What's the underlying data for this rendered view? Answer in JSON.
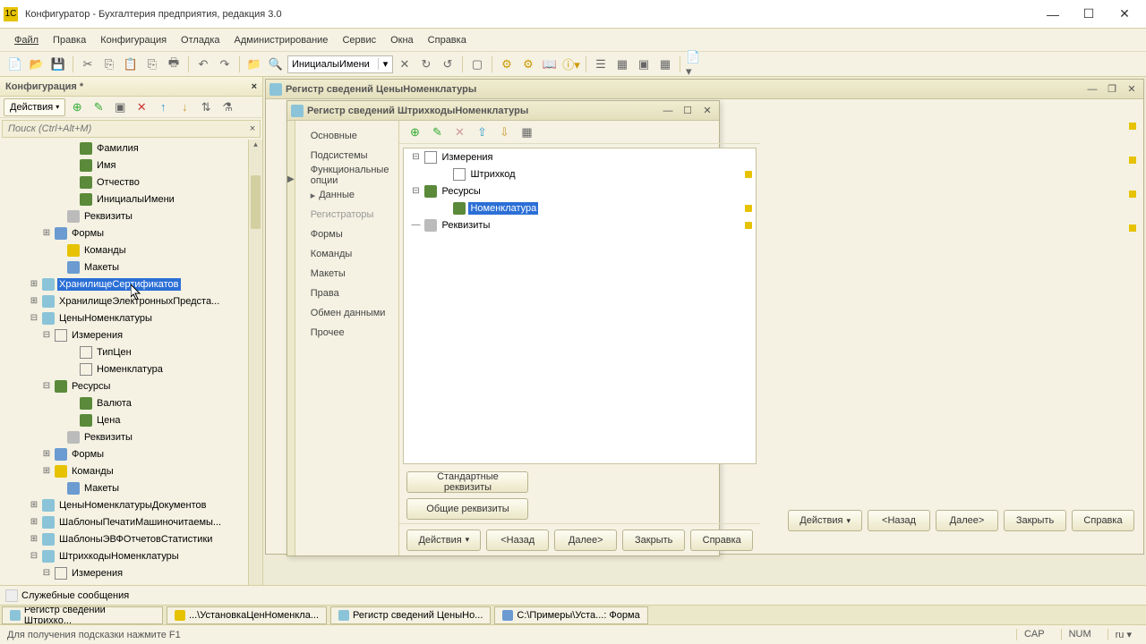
{
  "window": {
    "title": "Конфигуратор - Бухгалтерия предприятия, редакция 3.0",
    "min": "—",
    "max": "☐",
    "close": "✕"
  },
  "menu": {
    "file": "Файл",
    "edit": "Правка",
    "config": "Конфигурация",
    "debug": "Отладка",
    "admin": "Администрирование",
    "service": "Сервис",
    "windows": "Окна",
    "help": "Справка"
  },
  "toolbar": {
    "combo_value": "ИнициалыИмени"
  },
  "config_panel": {
    "title": "Конфигурация *",
    "actions": "Действия",
    "search_placeholder": "Поиск (Ctrl+Alt+M)",
    "tree": [
      {
        "indent": 5,
        "ico": "green",
        "label": "Фамилия",
        "mark": true
      },
      {
        "indent": 5,
        "ico": "green",
        "label": "Имя",
        "mark": true
      },
      {
        "indent": 5,
        "ico": "green",
        "label": "Отчество",
        "mark": true
      },
      {
        "indent": 5,
        "ico": "green",
        "label": "ИнициалыИмени",
        "mark": true
      },
      {
        "indent": 4,
        "exp": "",
        "ico": "gray",
        "label": "Реквизиты"
      },
      {
        "indent": 3,
        "exp": "+",
        "ico": "blue",
        "label": "Формы"
      },
      {
        "indent": 4,
        "ico": "yellow",
        "label": "Команды"
      },
      {
        "indent": 4,
        "ico": "blue",
        "label": "Макеты"
      },
      {
        "indent": 2,
        "exp": "+",
        "ico": "cyan",
        "label": "ХранилищеСертификатов",
        "sel": true,
        "mark": true
      },
      {
        "indent": 2,
        "exp": "+",
        "ico": "cyan",
        "label": "ХранилищеЭлектронныхПредста...",
        "mark": true
      },
      {
        "indent": 2,
        "exp": "-",
        "ico": "cyan",
        "label": "ЦеныНоменклатуры"
      },
      {
        "indent": 3,
        "exp": "-",
        "ico": "dim",
        "label": "Измерения"
      },
      {
        "indent": 5,
        "ico": "dim",
        "label": "ТипЦен"
      },
      {
        "indent": 5,
        "ico": "dim",
        "label": "Номенклатура"
      },
      {
        "indent": 3,
        "exp": "-",
        "ico": "green",
        "label": "Ресурсы"
      },
      {
        "indent": 5,
        "ico": "green",
        "label": "Валюта"
      },
      {
        "indent": 5,
        "ico": "green",
        "label": "Цена"
      },
      {
        "indent": 4,
        "ico": "gray",
        "label": "Реквизиты"
      },
      {
        "indent": 3,
        "exp": "+",
        "ico": "blue",
        "label": "Формы"
      },
      {
        "indent": 3,
        "exp": "+",
        "ico": "yellow",
        "label": "Команды"
      },
      {
        "indent": 4,
        "ico": "blue",
        "label": "Макеты"
      },
      {
        "indent": 2,
        "exp": "+",
        "ico": "cyan",
        "label": "ЦеныНоменклатурыДокументов"
      },
      {
        "indent": 2,
        "exp": "+",
        "ico": "cyan",
        "label": "ШаблоныПечатиМашиночитаемы..."
      },
      {
        "indent": 2,
        "exp": "+",
        "ico": "cyan",
        "label": "ШаблоныЭВФОтчетовСтатистики"
      },
      {
        "indent": 2,
        "exp": "-",
        "ico": "cyan",
        "label": "ШтрихкодыНоменклатуры"
      },
      {
        "indent": 3,
        "exp": "-",
        "ico": "dim",
        "label": "Измерения"
      }
    ]
  },
  "win1": {
    "title": "Регистр сведений ЦеныНоменклатуры",
    "footer": {
      "actions": "Действия",
      "back": "<Назад",
      "next": "Далее>",
      "close": "Закрыть",
      "help": "Справка"
    }
  },
  "win2": {
    "title": "Регистр сведений ШтрихкодыНоменклатуры",
    "tabs": {
      "main": "Основные",
      "subsystems": "Подсистемы",
      "funcopts": "Функциональные опции",
      "data": "Данные",
      "registrators": "Регистраторы",
      "forms": "Формы",
      "commands": "Команды",
      "templates": "Макеты",
      "rights": "Права",
      "exchange": "Обмен данными",
      "other": "Прочее"
    },
    "tree": [
      {
        "indent": 0,
        "exp": "-",
        "ico": "dim",
        "label": "Измерения"
      },
      {
        "indent": 2,
        "ico": "dim",
        "label": "Штрихкод",
        "mark": true
      },
      {
        "indent": 0,
        "exp": "-",
        "ico": "green",
        "label": "Ресурсы"
      },
      {
        "indent": 2,
        "ico": "green",
        "label": "Номенклатура",
        "sel": true,
        "mark": true
      },
      {
        "indent": 0,
        "exp": "",
        "ico": "gray",
        "label": "Реквизиты",
        "mark": true
      }
    ],
    "btn_std": "Стандартные реквизиты",
    "btn_common": "Общие реквизиты",
    "footer": {
      "actions": "Действия",
      "back": "<Назад",
      "next": "Далее>",
      "close": "Закрыть",
      "help": "Справка"
    }
  },
  "svc": {
    "label": "Служебные сообщения"
  },
  "tasks": {
    "t1": "Регистр сведений Штрихко...",
    "t2": "...\\УстановкаЦенНоменкла...",
    "t3": "Регистр сведений ЦеныНо...",
    "t4": "C:\\Примеры\\Уста...: Форма"
  },
  "status": {
    "hint": "Для получения подсказки нажмите F1",
    "cap": "CAP",
    "num": "NUM",
    "lang": "ru ▾"
  }
}
